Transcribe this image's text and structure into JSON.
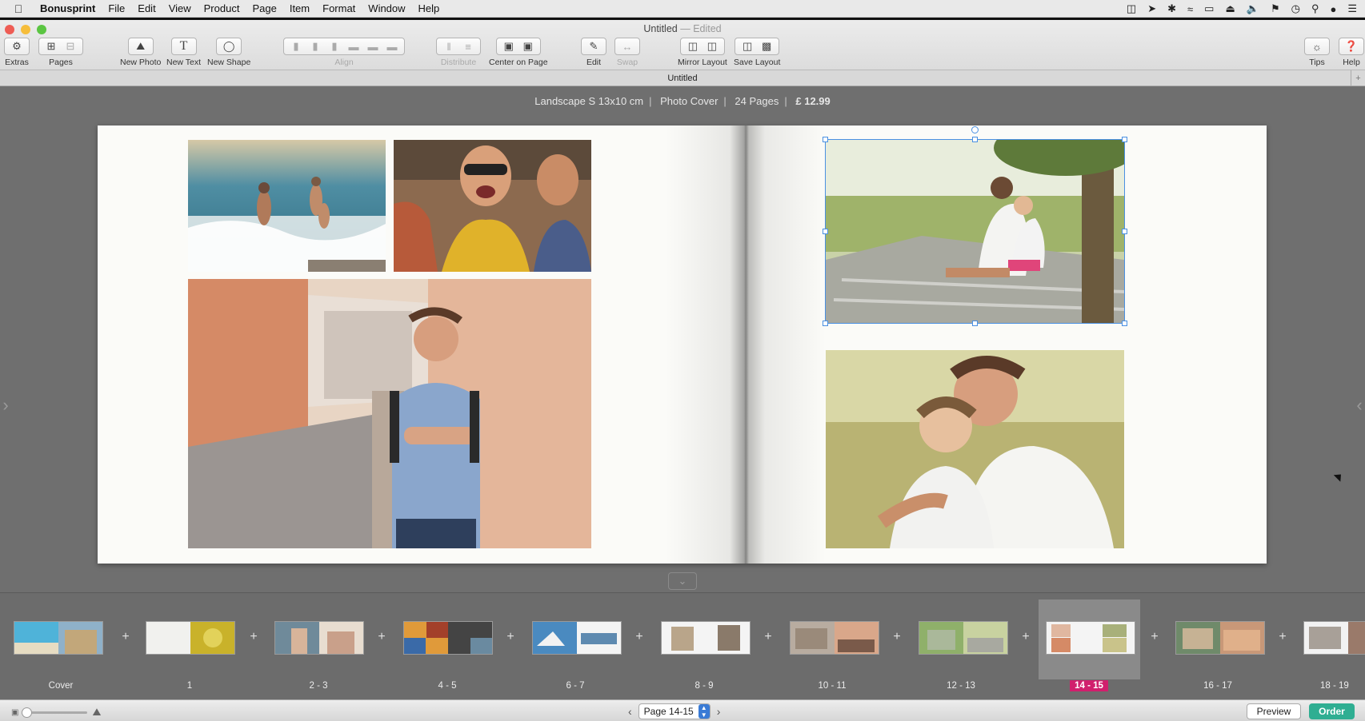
{
  "menubar": {
    "app": "Bonusprint",
    "items": [
      "File",
      "Edit",
      "View",
      "Product",
      "Page",
      "Item",
      "Format",
      "Window",
      "Help"
    ]
  },
  "window": {
    "title": "Untitled",
    "edited": "— Edited",
    "tab": "Untitled"
  },
  "toolbar": {
    "extras": "Extras",
    "pages": "Pages",
    "new_photo": "New Photo",
    "new_text": "New Text",
    "new_shape": "New Shape",
    "align": "Align",
    "distribute": "Distribute",
    "center_on_page": "Center on Page",
    "edit": "Edit",
    "swap": "Swap",
    "mirror_layout": "Mirror Layout",
    "save_layout": "Save Layout",
    "tips": "Tips",
    "help": "Help"
  },
  "product_info": {
    "format": "Landscape S 13x10 cm",
    "cover": "Photo Cover",
    "pages": "24 Pages",
    "price": "£ 12.99"
  },
  "thumbnails": [
    {
      "label": "Cover"
    },
    {
      "label": "1"
    },
    {
      "label": "2 - 3"
    },
    {
      "label": "4 - 5"
    },
    {
      "label": "6 - 7"
    },
    {
      "label": "8 - 9"
    },
    {
      "label": "10 - 11"
    },
    {
      "label": "12 - 13"
    },
    {
      "label": "14 - 15",
      "active": true
    },
    {
      "label": "16 - 17"
    },
    {
      "label": "18 - 19"
    }
  ],
  "pager": {
    "current": "Page 14-15"
  },
  "buttons": {
    "preview": "Preview",
    "order": "Order"
  },
  "colors": {
    "accent_active_page": "#d11f6d",
    "order_button": "#2fae92",
    "selection": "#4a90e2"
  }
}
